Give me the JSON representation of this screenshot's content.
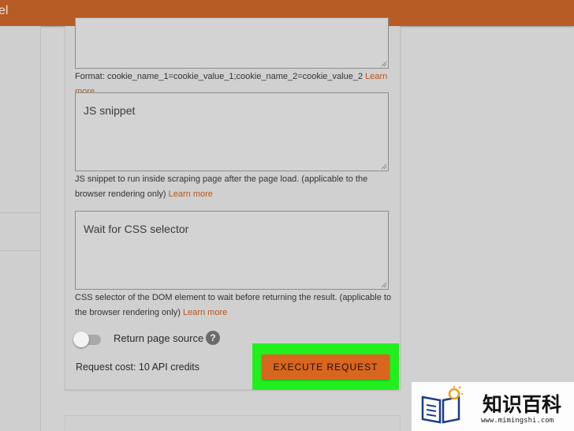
{
  "header": {
    "title_fragment": "el"
  },
  "form": {
    "cookies": {
      "help_text": "Format: cookie_name_1=cookie_value_1;cookie_name_2=cookie_value_2",
      "learn_more": "Learn more"
    },
    "js_snippet": {
      "placeholder": "JS snippet",
      "help_text": "JS snippet to run inside scraping page after the page load. (applicable to the browser rendering only)",
      "learn_more": "Learn more"
    },
    "wait_selector": {
      "placeholder": "Wait for CSS selector",
      "help_text": "CSS selector of the DOM element to wait before returning the result. (applicable to the browser rendering only)",
      "learn_more": "Learn more"
    },
    "return_source": {
      "label": "Return page source",
      "help_icon": "?",
      "enabled": false
    },
    "request_cost": "Request cost: 10 API credits",
    "execute_button": "EXECUTE REQUEST"
  },
  "watermark": {
    "text": "知识百科",
    "url": "www.mimingshi.com"
  },
  "colors": {
    "header": "#b75c24",
    "accent": "#d8661e",
    "link": "#b8541a",
    "highlight": "#22f01e"
  }
}
